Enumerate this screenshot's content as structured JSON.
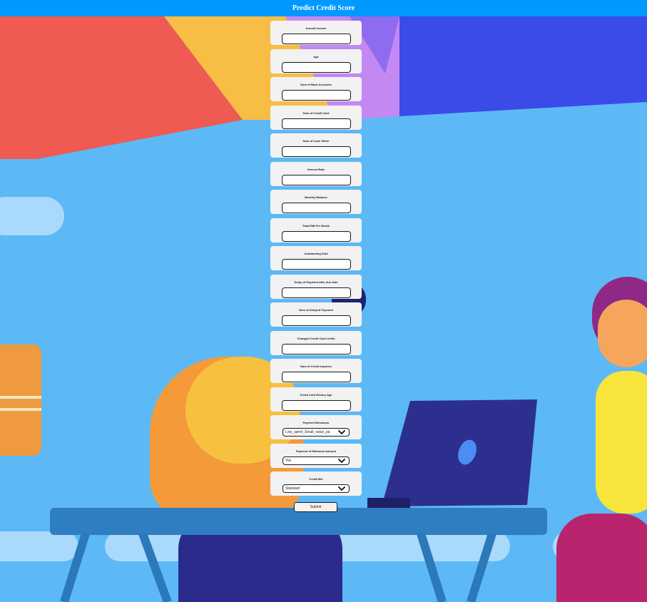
{
  "header": {
    "title": "Predict Credit Score"
  },
  "form": {
    "fields": [
      {
        "label": "Annual Income",
        "value": ""
      },
      {
        "label": "Age",
        "value": ""
      },
      {
        "label": "Num of Bank Accounts",
        "value": ""
      },
      {
        "label": "Num of Credit Card",
        "value": ""
      },
      {
        "label": "Num of Loan Taken",
        "value": ""
      },
      {
        "label": "Interest Rate",
        "value": ""
      },
      {
        "label": "Monthly Balance",
        "value": ""
      },
      {
        "label": "Total EMI Per Month",
        "value": ""
      },
      {
        "label": "Outstanding Debt",
        "value": ""
      },
      {
        "label": "Delay of Payment after due date",
        "value": ""
      },
      {
        "label": "Num of Delayed Payment",
        "value": ""
      },
      {
        "label": "Changed Credit Card Limits",
        "value": ""
      },
      {
        "label": "Num of Credit Inquiries",
        "value": ""
      },
      {
        "label": "Credit Card History Age",
        "value": ""
      }
    ],
    "selects": [
      {
        "label": "Payment Behaviour",
        "value": "Low_spent_Small_value_pa"
      },
      {
        "label": "Payment of Minimum Amount",
        "value": "Yes"
      },
      {
        "label": "Credit Mix",
        "value": "Standard"
      }
    ],
    "submit_label": "Submit"
  },
  "colors": {
    "header_bg": "#0099ff",
    "field_bg": "#f2f2f2",
    "page_bg": "#5bb8f5"
  },
  "icons": {
    "select_arrow": "chevron-down-icon"
  }
}
